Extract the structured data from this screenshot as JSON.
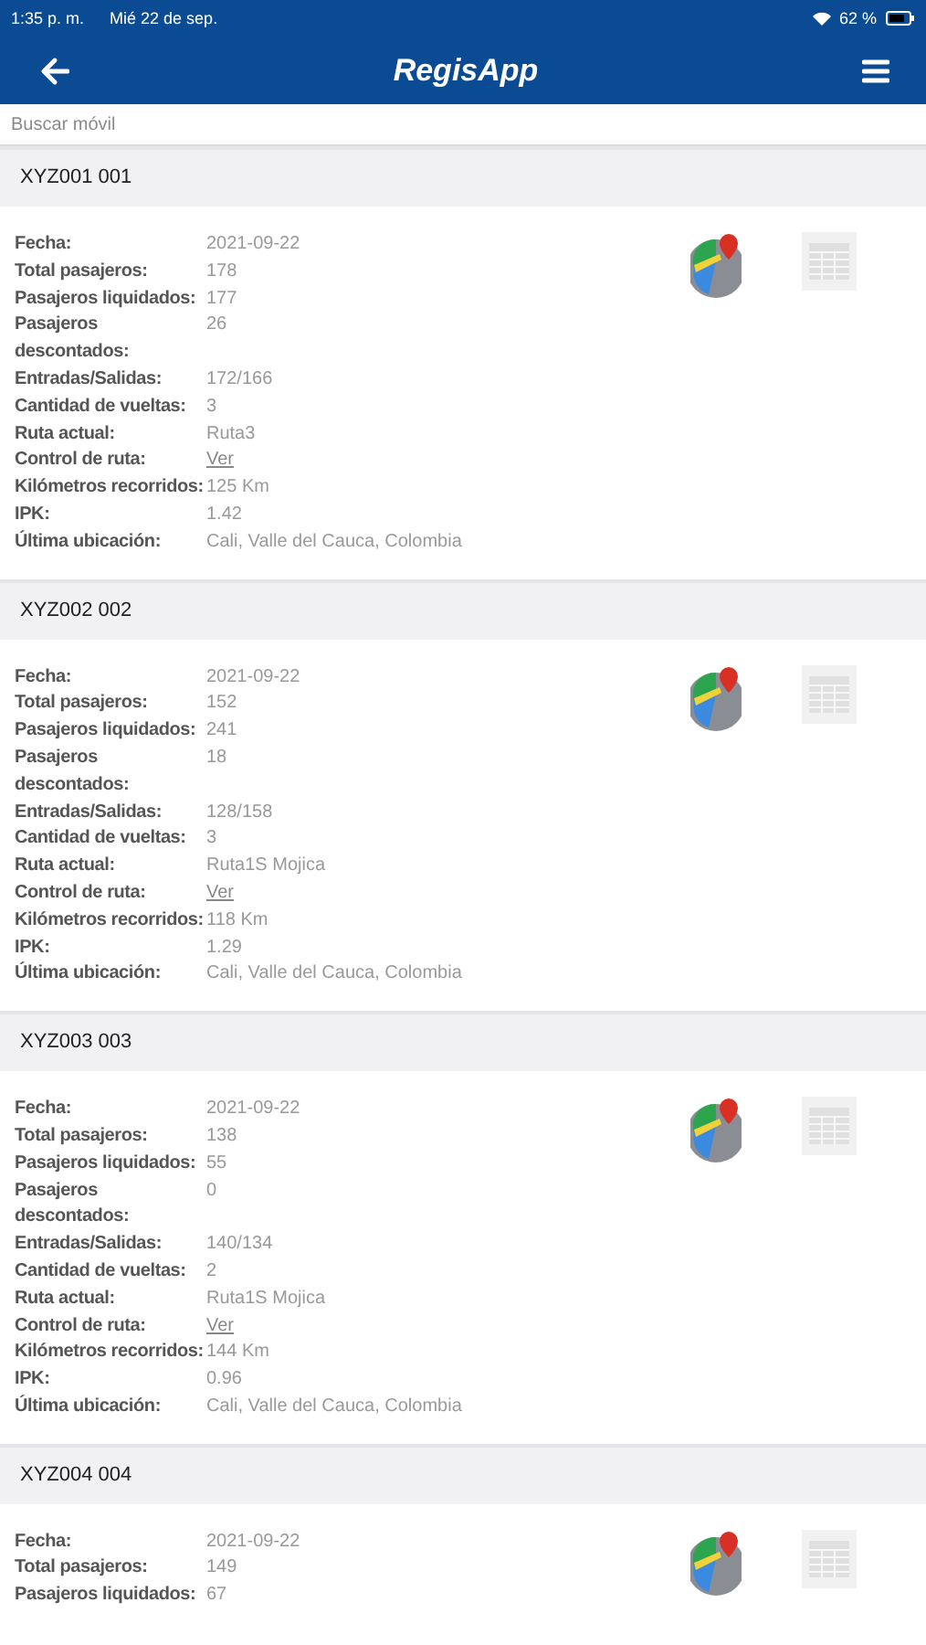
{
  "status_bar": {
    "time": "1:35 p. m.",
    "date": "Mié 22 de sep.",
    "battery": "62 %"
  },
  "header": {
    "title": "RegisApp"
  },
  "search": {
    "placeholder": "Buscar móvil"
  },
  "vehicles": [
    {
      "name": "XYZ001 001",
      "fields": [
        {
          "label": "Fecha:",
          "value": "2021-09-22",
          "kind": "text"
        },
        {
          "label": "Total pasajeros:",
          "value": "178",
          "kind": "text"
        },
        {
          "label": "Pasajeros liquidados:",
          "value": "177",
          "kind": "text"
        },
        {
          "label": "Pasajeros descontados:",
          "value": "26",
          "kind": "text"
        },
        {
          "label": "Entradas/Salidas:",
          "value": "172/166",
          "kind": "text"
        },
        {
          "label": "Cantidad de vueltas:",
          "value": "3",
          "kind": "text"
        },
        {
          "label": "Ruta actual:",
          "value": "Ruta3",
          "kind": "text"
        },
        {
          "label": "Control de ruta:",
          "value": "Ver",
          "kind": "link"
        },
        {
          "label": "Kilómetros recorridos:",
          "value": "125 Km",
          "kind": "text"
        },
        {
          "label": "IPK:",
          "value": "1.42",
          "kind": "text"
        },
        {
          "label": "Última ubicación:",
          "value": "Cali, Valle del Cauca, Colombia",
          "kind": "text"
        }
      ]
    },
    {
      "name": "XYZ002 002",
      "fields": [
        {
          "label": "Fecha:",
          "value": "2021-09-22",
          "kind": "text"
        },
        {
          "label": "Total pasajeros:",
          "value": "152",
          "kind": "text"
        },
        {
          "label": "Pasajeros liquidados:",
          "value": "241",
          "kind": "text"
        },
        {
          "label": "Pasajeros descontados:",
          "value": "18",
          "kind": "text"
        },
        {
          "label": "Entradas/Salidas:",
          "value": "128/158",
          "kind": "text"
        },
        {
          "label": "Cantidad de vueltas:",
          "value": "3",
          "kind": "text"
        },
        {
          "label": "Ruta actual:",
          "value": "Ruta1S Mojica",
          "kind": "text"
        },
        {
          "label": "Control de ruta:",
          "value": "Ver",
          "kind": "link"
        },
        {
          "label": "Kilómetros recorridos:",
          "value": "118 Km",
          "kind": "text"
        },
        {
          "label": "IPK:",
          "value": "1.29",
          "kind": "text"
        },
        {
          "label": "Última ubicación:",
          "value": "Cali, Valle del Cauca, Colombia",
          "kind": "text"
        }
      ]
    },
    {
      "name": "XYZ003 003",
      "fields": [
        {
          "label": "Fecha:",
          "value": "2021-09-22",
          "kind": "text"
        },
        {
          "label": "Total pasajeros:",
          "value": "138",
          "kind": "text"
        },
        {
          "label": "Pasajeros liquidados:",
          "value": "55",
          "kind": "text"
        },
        {
          "label": "Pasajeros descontados:",
          "value": "0",
          "kind": "text"
        },
        {
          "label": "Entradas/Salidas:",
          "value": "140/134",
          "kind": "text"
        },
        {
          "label": "Cantidad de vueltas:",
          "value": "2",
          "kind": "text"
        },
        {
          "label": "Ruta actual:",
          "value": "Ruta1S Mojica",
          "kind": "text"
        },
        {
          "label": "Control de ruta:",
          "value": "Ver",
          "kind": "link"
        },
        {
          "label": "Kilómetros recorridos:",
          "value": "144 Km",
          "kind": "text"
        },
        {
          "label": "IPK:",
          "value": "0.96",
          "kind": "text"
        },
        {
          "label": "Última ubicación:",
          "value": "Cali, Valle del Cauca, Colombia",
          "kind": "text"
        }
      ]
    },
    {
      "name": "XYZ004 004",
      "fields": [
        {
          "label": "Fecha:",
          "value": "2021-09-22",
          "kind": "text"
        },
        {
          "label": "Total pasajeros:",
          "value": "149",
          "kind": "text"
        },
        {
          "label": "Pasajeros liquidados:",
          "value": "67",
          "kind": "text"
        }
      ]
    }
  ]
}
